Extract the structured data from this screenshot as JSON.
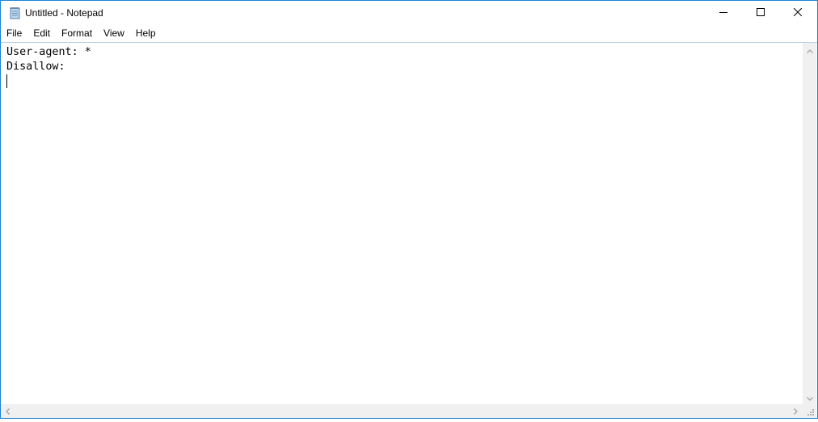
{
  "window": {
    "title": "Untitled - Notepad",
    "app_icon": "notepad-icon",
    "accent_color": "#1883d7"
  },
  "caption_buttons": {
    "minimize": "minimize-icon",
    "maximize": "maximize-icon",
    "close": "close-icon"
  },
  "menu": {
    "items": [
      {
        "label": "File"
      },
      {
        "label": "Edit"
      },
      {
        "label": "Format"
      },
      {
        "label": "View"
      },
      {
        "label": "Help"
      }
    ]
  },
  "editor": {
    "lines": [
      "User-agent: *",
      "Disallow:",
      ""
    ]
  },
  "scrollbars": {
    "vertical": {
      "up": "chevron-up-icon",
      "down": "chevron-down-icon"
    },
    "horizontal": {
      "left": "chevron-left-icon",
      "right": "chevron-right-icon"
    },
    "grip": "size-grip-icon"
  }
}
